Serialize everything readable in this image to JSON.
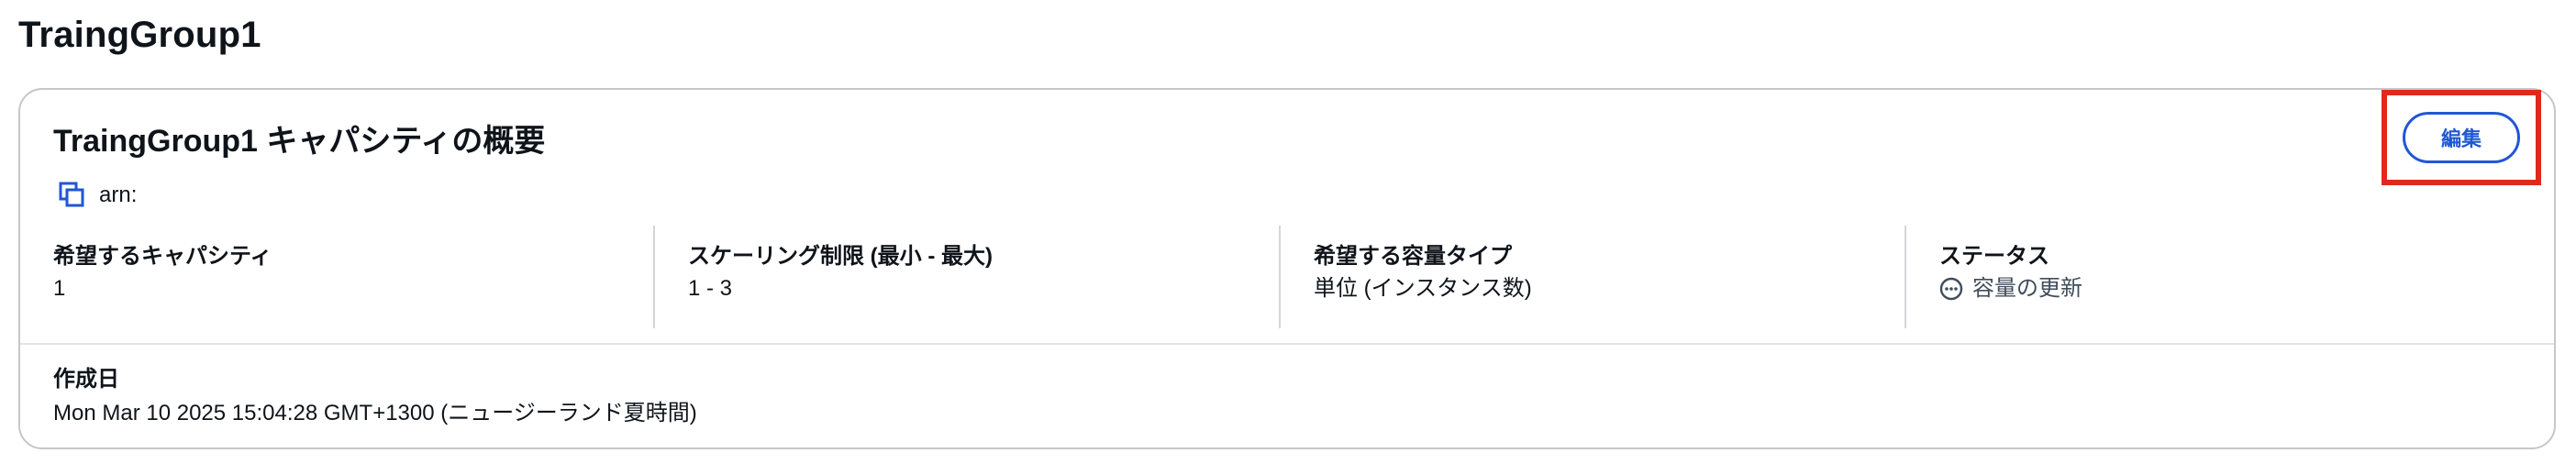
{
  "page": {
    "title": "TraingGroup1"
  },
  "card": {
    "title": "TraingGroup1 キャパシティの概要",
    "arn_label": "arn:",
    "edit_label": "編集",
    "metrics": [
      {
        "label": "希望するキャパシティ",
        "value": "1"
      },
      {
        "label": "スケーリング制限 (最小 - 最大)",
        "value": "1 - 3"
      },
      {
        "label": "希望する容量タイプ",
        "value": "単位 (インスタンス数)"
      },
      {
        "label": "ステータス",
        "value": "容量の更新",
        "icon": "ellipsis-circle-icon"
      }
    ],
    "created": {
      "label": "作成日",
      "value": "Mon Mar 10 2025 15:04:28 GMT+1300 (ニュージーランド夏時間)"
    }
  },
  "colors": {
    "accent": "#1f57d6",
    "highlight": "#e0291e",
    "border": "#c6c6cd"
  }
}
